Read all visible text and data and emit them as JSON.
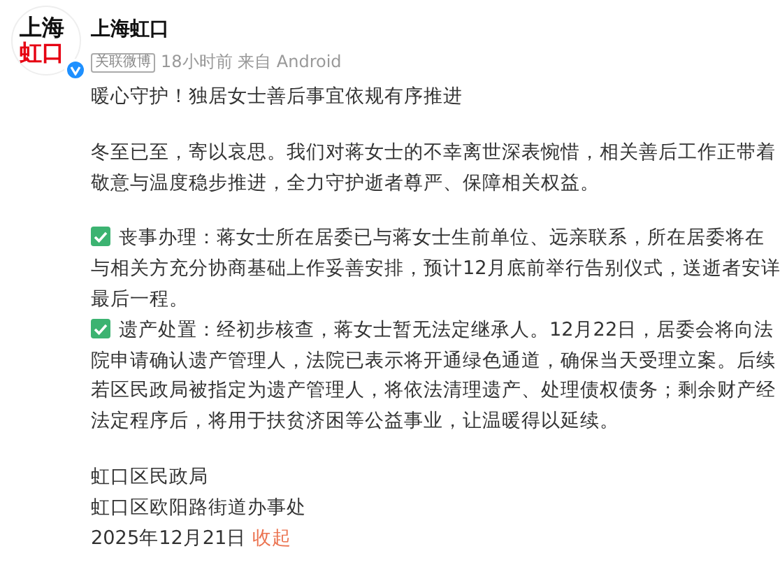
{
  "avatar": {
    "logo_top": "上海",
    "logo_bottom": "虹口",
    "verified": true
  },
  "account": {
    "name": "上海虹口",
    "tag": "关联微博",
    "meta": "18小时前 来自 Android"
  },
  "post": {
    "title": "暖心守护！独居女士善后事宜依规有序推进",
    "blocks": [
      {
        "kind": "paragraph",
        "text": "冬至已至，寄以哀思。我们对蒋女士的不幸离世深表惋惜，相关善后工作正带着敬意与温度稳步推进，全力守护逝者尊严、保障相关权益。"
      },
      {
        "kind": "checklist",
        "items": [
          {
            "checked": true,
            "text": "丧事办理：蒋女士所在居委已与蒋女士生前单位、远亲联系，所在居委将在与相关方充分协商基础上作妥善安排，预计12月底前举行告别仪式，送逝者安详最后一程。"
          },
          {
            "checked": true,
            "text": "遗产处置：经初步核查，蒋女士暂无法定继承人。12月22日，居委会将向法院申请确认遗产管理人，法院已表示将开通绿色通道，确保当天受理立案。后续若区民政局被指定为遗产管理人，将依法清理遗产、处理债权债务；剩余财产经法定程序后，将用于扶贫济困等公益事业，让温暖得以延续。"
          }
        ]
      }
    ],
    "signature": [
      "虹口区民政局",
      "虹口区欧阳路街道办事处"
    ],
    "date": "2025年12月21日",
    "collapse_link": "收起"
  }
}
